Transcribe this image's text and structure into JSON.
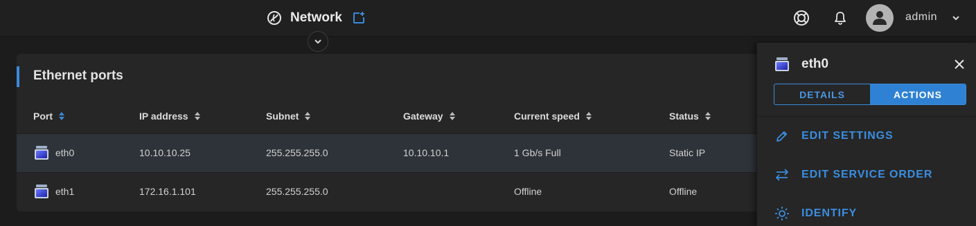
{
  "header": {
    "title": "Network",
    "user": "admin"
  },
  "card": {
    "title": "Ethernet ports",
    "columns": [
      "Port",
      "IP address",
      "Subnet",
      "Gateway",
      "Current speed",
      "Status"
    ],
    "rows": [
      {
        "port": "eth0",
        "ip": "10.10.10.25",
        "subnet": "255.255.255.0",
        "gateway": "10.10.10.1",
        "speed": "1 Gb/s Full",
        "status": "Static IP",
        "selected": true
      },
      {
        "port": "eth1",
        "ip": "172.16.1.101",
        "subnet": "255.255.255.0",
        "gateway": "",
        "speed": "Offline",
        "status": "Offline",
        "selected": false
      }
    ]
  },
  "panel": {
    "title": "eth0",
    "tabs": [
      {
        "label": "DETAILS",
        "active": false
      },
      {
        "label": "ACTIONS",
        "active": true
      }
    ],
    "actions": [
      {
        "label": "EDIT SETTINGS",
        "icon": "pencil-icon"
      },
      {
        "label": "EDIT SERVICE ORDER",
        "icon": "swap-arrows-icon"
      },
      {
        "label": "IDENTIFY",
        "icon": "sun-icon"
      }
    ]
  },
  "colors": {
    "accent": "#3b8ad9",
    "background": "#1c1c1c",
    "card": "#262626",
    "selected_row": "#2e3339"
  }
}
